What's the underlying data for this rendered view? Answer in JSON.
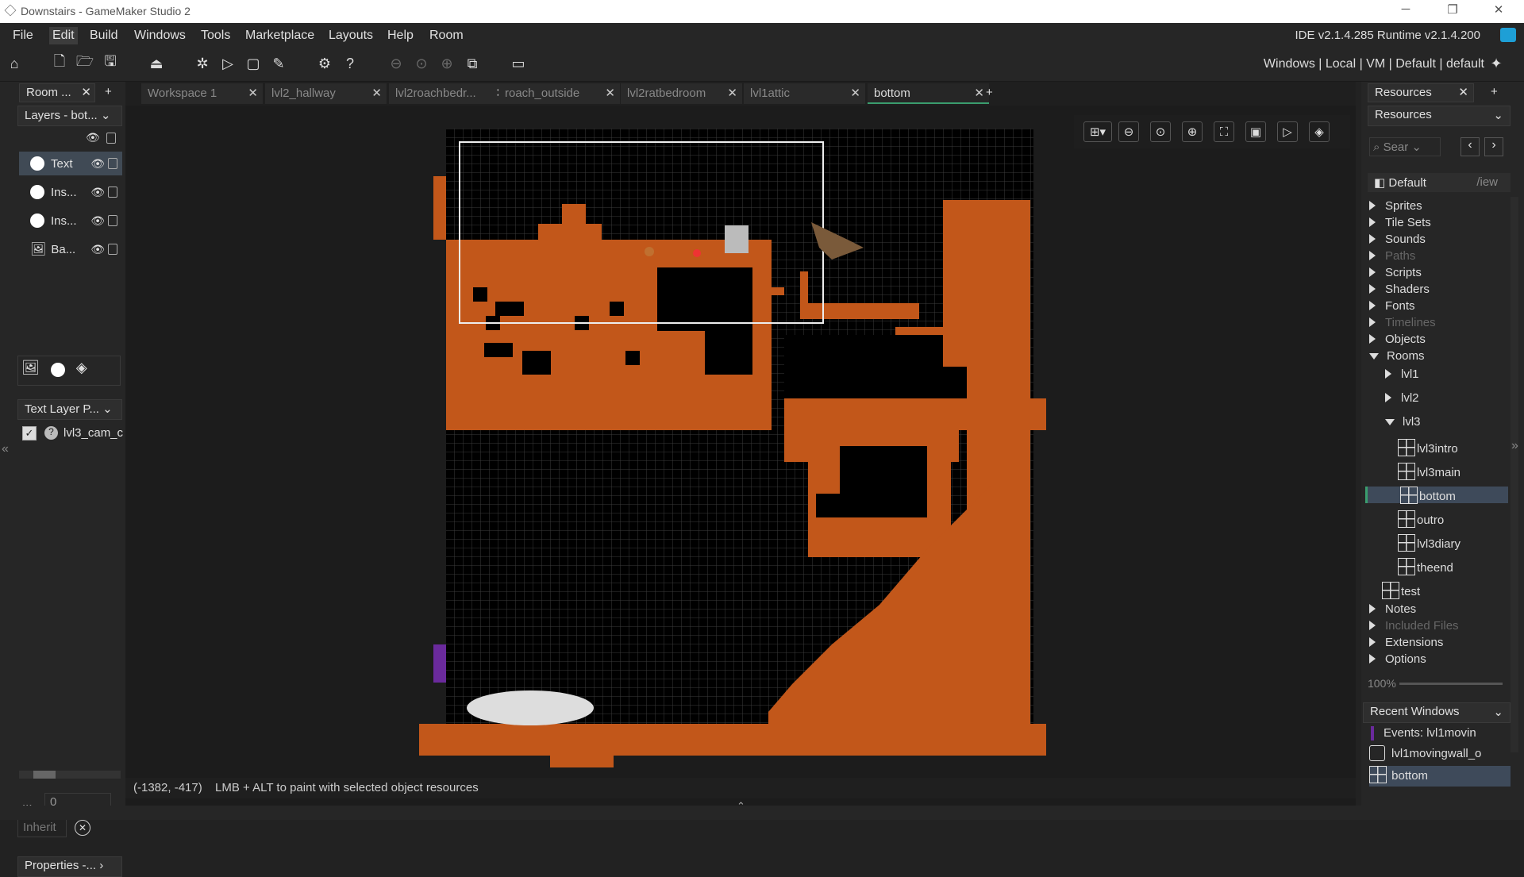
{
  "window": {
    "title": "Downstairs - GameMaker Studio 2"
  },
  "menu": {
    "items": [
      "File",
      "Edit",
      "Build",
      "Windows",
      "Tools",
      "Marketplace",
      "Layouts",
      "Help",
      "Room"
    ],
    "version": "IDE v2.1.4.285 Runtime v2.1.4.200"
  },
  "toolbar": {
    "target": "Windows | Local | VM | Default | default"
  },
  "left": {
    "room_tab": "Room ...",
    "layers_label": "Layers - bot...",
    "layers": [
      {
        "name": "Text"
      },
      {
        "name": "Ins..."
      },
      {
        "name": "Ins..."
      },
      {
        "name": "Ba..."
      }
    ],
    "text_props": "Text Layer P...",
    "instance": "lvl3_cam_c",
    "depth_label": "...",
    "depth_value": "0",
    "inherit": "Inherit",
    "properties": "Properties -..."
  },
  "tabs": [
    {
      "label": "Workspace 1"
    },
    {
      "label": "lvl2_hallway"
    },
    {
      "label": "lvl2roachbedr..."
    },
    {
      "label": "roach_outside"
    },
    {
      "label": "lvl2ratbedroom"
    },
    {
      "label": "lvl1attic"
    },
    {
      "label": "bottom",
      "active": true
    }
  ],
  "status": {
    "coords": "(-1382, -417)",
    "hint": "LMB + ALT to paint with selected object resources"
  },
  "resources": {
    "tab": "Resources",
    "dropdown": "Resources",
    "search_placeholder": "Sear",
    "default": "Default",
    "view": "/iew",
    "zoom": "100%",
    "tree": [
      {
        "label": "Sprites"
      },
      {
        "label": "Tile Sets"
      },
      {
        "label": "Sounds"
      },
      {
        "label": "Paths",
        "dim": true
      },
      {
        "label": "Scripts"
      },
      {
        "label": "Shaders"
      },
      {
        "label": "Fonts"
      },
      {
        "label": "Timelines",
        "dim": true
      },
      {
        "label": "Objects"
      },
      {
        "label": "Rooms",
        "open": true
      }
    ],
    "rooms": {
      "lvl1": "lvl1",
      "lvl2": "lvl2",
      "lvl3": "lvl3",
      "lvl3_rooms": [
        "lvl3intro",
        "lvl3main",
        "bottom",
        "outro",
        "lvl3diary",
        "theend"
      ],
      "test": "test"
    },
    "tree2": [
      {
        "label": "Notes"
      },
      {
        "label": "Included Files",
        "dim": true
      },
      {
        "label": "Extensions"
      },
      {
        "label": "Options"
      }
    ],
    "recent_title": "Recent Windows",
    "recent": [
      "Events: lvl1movin",
      "lvl1movingwall_o",
      "bottom"
    ]
  },
  "colors": {
    "dirt": "#c2571a",
    "accent": "#3a9d6e"
  }
}
